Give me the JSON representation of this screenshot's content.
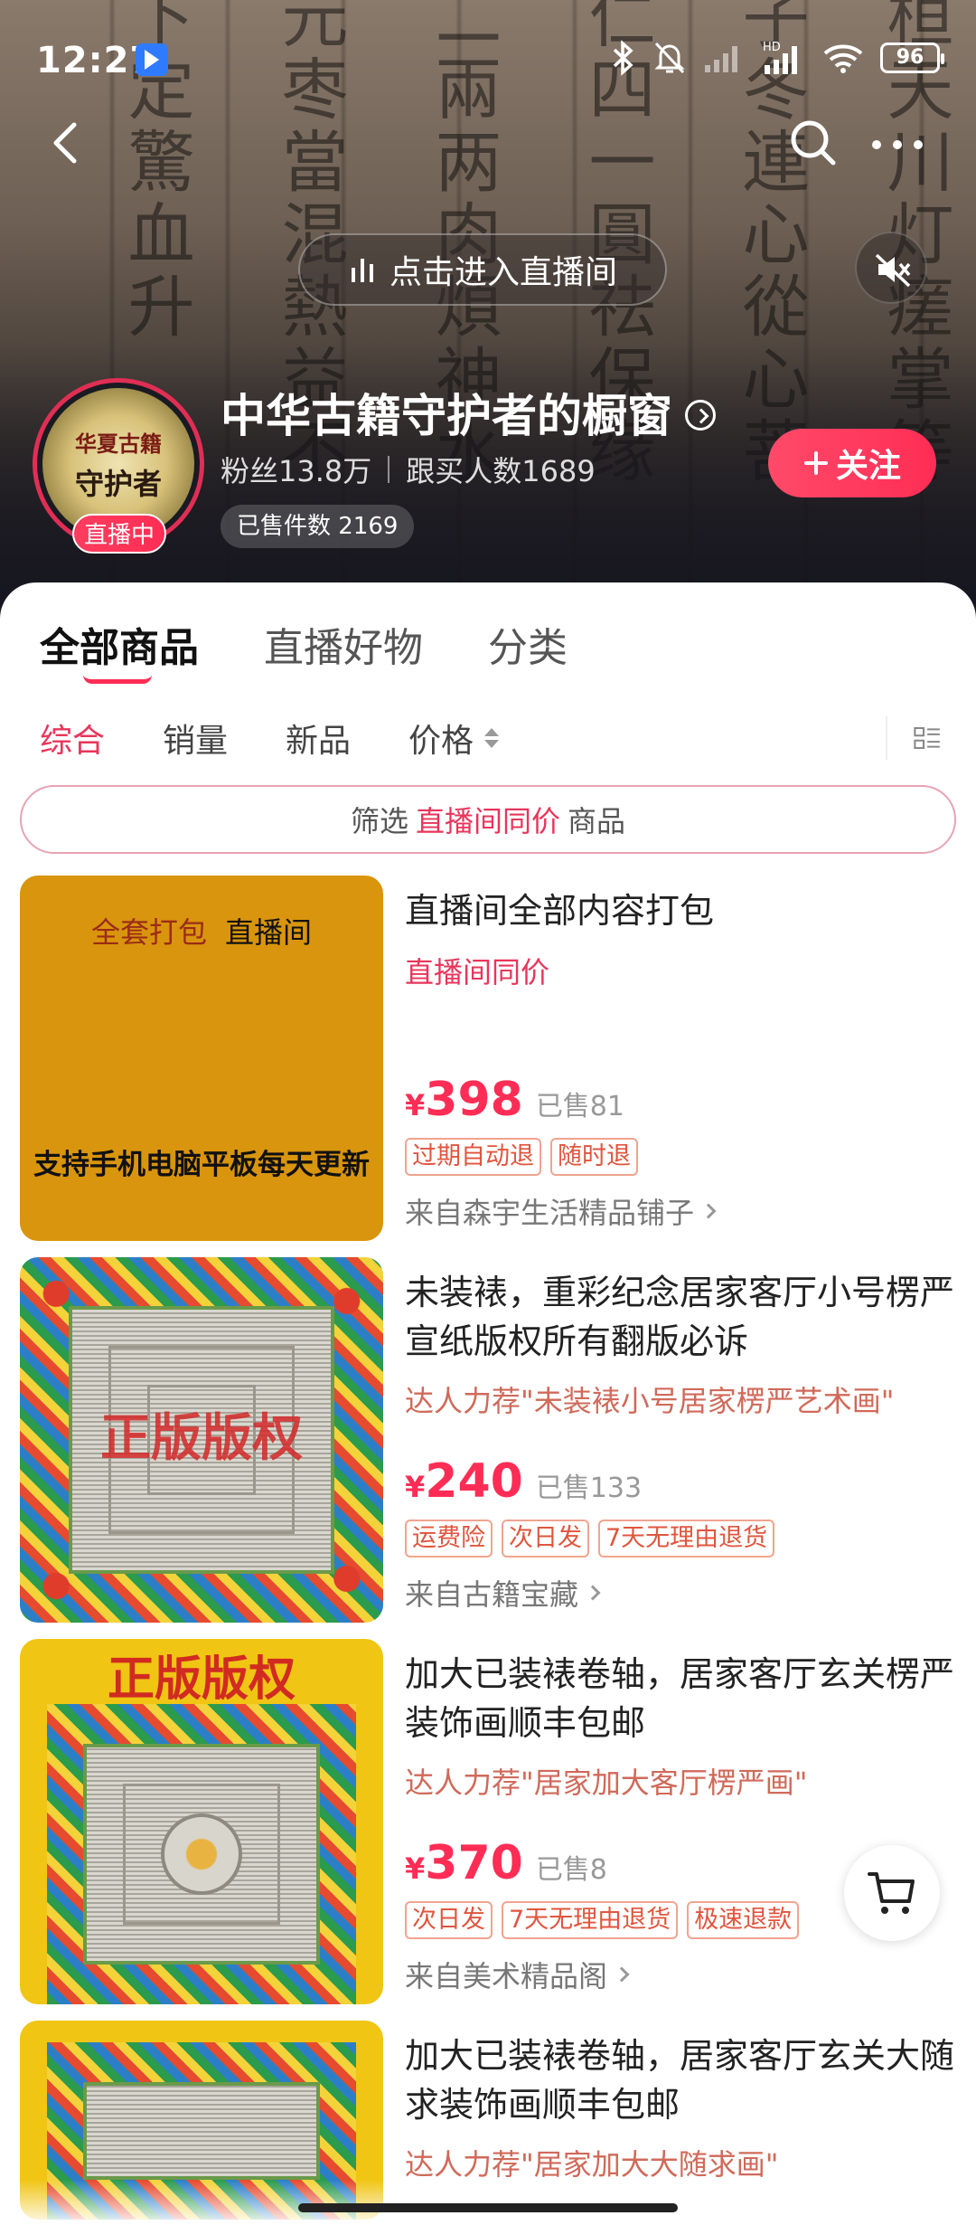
{
  "status_bar": {
    "time": "12:27",
    "battery": "96"
  },
  "header": {
    "background_text": [
      "桓天川灯瘥掌等",
      "子冬連心從心菩",
      "仁四一圓祛保缘",
      "二兩两肉煩神水",
      "元枣當混熱益不",
      "下定驚血升"
    ],
    "live_entry_label": "点击进入直播间"
  },
  "store": {
    "avatar_top_text": "华夏古籍",
    "avatar_main_text": "守护者",
    "live_badge": "直播中",
    "name": "中华古籍守护者的橱窗",
    "fans": "粉丝13.8万",
    "buyers": "跟买人数1689",
    "sold_count": "已售件数 2169",
    "follow_label": "关注"
  },
  "tabs": [
    {
      "label": "全部商品",
      "active": true
    },
    {
      "label": "直播好物",
      "active": false
    },
    {
      "label": "分类",
      "active": false
    }
  ],
  "sort": [
    {
      "label": "综合",
      "active": true
    },
    {
      "label": "销量",
      "active": false
    },
    {
      "label": "新品",
      "active": false
    },
    {
      "label": "价格",
      "active": false
    }
  ],
  "filter": {
    "prefix": "筛选",
    "highlight": "直播间同价",
    "suffix": "商品"
  },
  "products": [
    {
      "image_text_1a": "全套打包",
      "image_text_1b": "直播间",
      "image_text_2": "支持手机电脑平板每天更新",
      "title": "直播间全部内容打包",
      "subtitle": "直播间同价",
      "currency": "¥",
      "price": "398",
      "sold": "已售81",
      "tags": [
        "过期自动退",
        "随时退"
      ],
      "shop": "来自森宇生活精品铺子"
    },
    {
      "image_stamp": "正版版权",
      "title": "未装裱，重彩纪念居家客厅小号楞严宣纸版权所有翻版必诉",
      "subtitle": "达人力荐\"未装裱小号居家楞严艺术画\"",
      "currency": "¥",
      "price": "240",
      "sold": "已售133",
      "tags": [
        "运费险",
        "次日发",
        "7天无理由退货"
      ],
      "shop": "来自古籍宝藏"
    },
    {
      "image_stamp": "正版版权",
      "title": "加大已装裱卷轴，居家客厅玄关楞严装饰画顺丰包邮",
      "subtitle": "达人力荐\"居家加大客厅楞严画\"",
      "currency": "¥",
      "price": "370",
      "sold": "已售8",
      "tags": [
        "次日发",
        "7天无理由退货",
        "极速退款"
      ],
      "shop": "来自美术精品阁"
    },
    {
      "title": "加大已装裱卷轴，居家客厅玄关大随求装饰画顺丰包邮",
      "subtitle": "达人力荐\"居家加大大随求画\""
    }
  ],
  "colors": {
    "accent": "#ff2d55",
    "tag": "#e0553e",
    "recommend": "#d06a5a"
  }
}
